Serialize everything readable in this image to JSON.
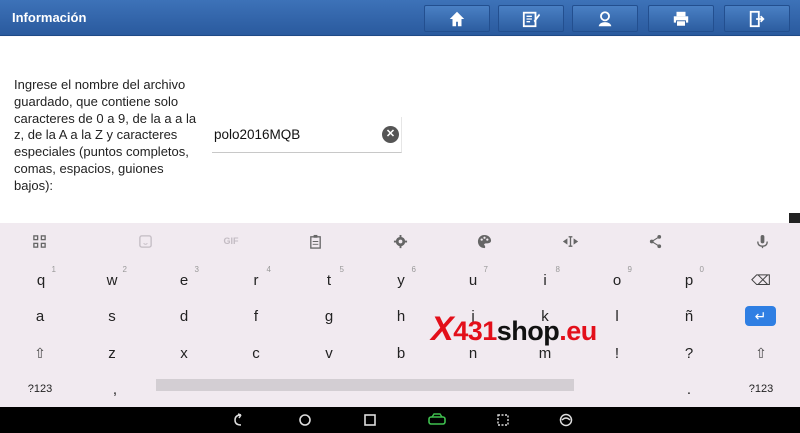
{
  "header": {
    "title": "Información",
    "buttons": [
      "home-icon",
      "edit-report-icon",
      "support-person-icon",
      "printer-icon",
      "exit-icon"
    ]
  },
  "form": {
    "instructions": "Ingrese el nombre del archivo guardado, que contiene solo caracteres de 0 a 9, de la a a la z, de la A a la Z y caracteres especiales (puntos completos, comas, espacios, guiones bajos):",
    "filename_value": "polo2016MQB",
    "clear_symbol": "✕"
  },
  "keyboard": {
    "toolbar": {
      "gif_label": "GIF",
      "icons": [
        "grid-icon",
        "sticker-icon",
        "gif-icon",
        "clipboard-icon",
        "settings-icon",
        "palette-icon",
        "cursor-move-icon",
        "share-icon",
        "mic-icon"
      ]
    },
    "row1": [
      {
        "ch": "q",
        "hint": "1"
      },
      {
        "ch": "w",
        "hint": "2"
      },
      {
        "ch": "e",
        "hint": "3"
      },
      {
        "ch": "r",
        "hint": "4"
      },
      {
        "ch": "t",
        "hint": "5"
      },
      {
        "ch": "y",
        "hint": "6"
      },
      {
        "ch": "u",
        "hint": "7"
      },
      {
        "ch": "i",
        "hint": "8"
      },
      {
        "ch": "o",
        "hint": "9"
      },
      {
        "ch": "p",
        "hint": "0"
      }
    ],
    "row2": [
      "a",
      "s",
      "d",
      "f",
      "g",
      "h",
      "j",
      "k",
      "l",
      "ñ"
    ],
    "row3": [
      "z",
      "x",
      "c",
      "v",
      "b",
      "n",
      "m",
      "!",
      "?"
    ],
    "row4": {
      "symbols": "?123",
      "comma": ",",
      "period": ".",
      "emoji_symbols": "?123"
    },
    "shift_symbol": "⇧",
    "enter_symbol": "↵",
    "backspace_symbol": "⌫",
    "accent_color": "#2f7fe3"
  },
  "watermark": {
    "x": "X",
    "num": "431",
    "shop": "shop",
    "dot": ".eu"
  },
  "navbar": {
    "icons": [
      "back-icon",
      "home-icon",
      "recents-icon",
      "car-diagnostic-icon",
      "browser-icon"
    ]
  }
}
